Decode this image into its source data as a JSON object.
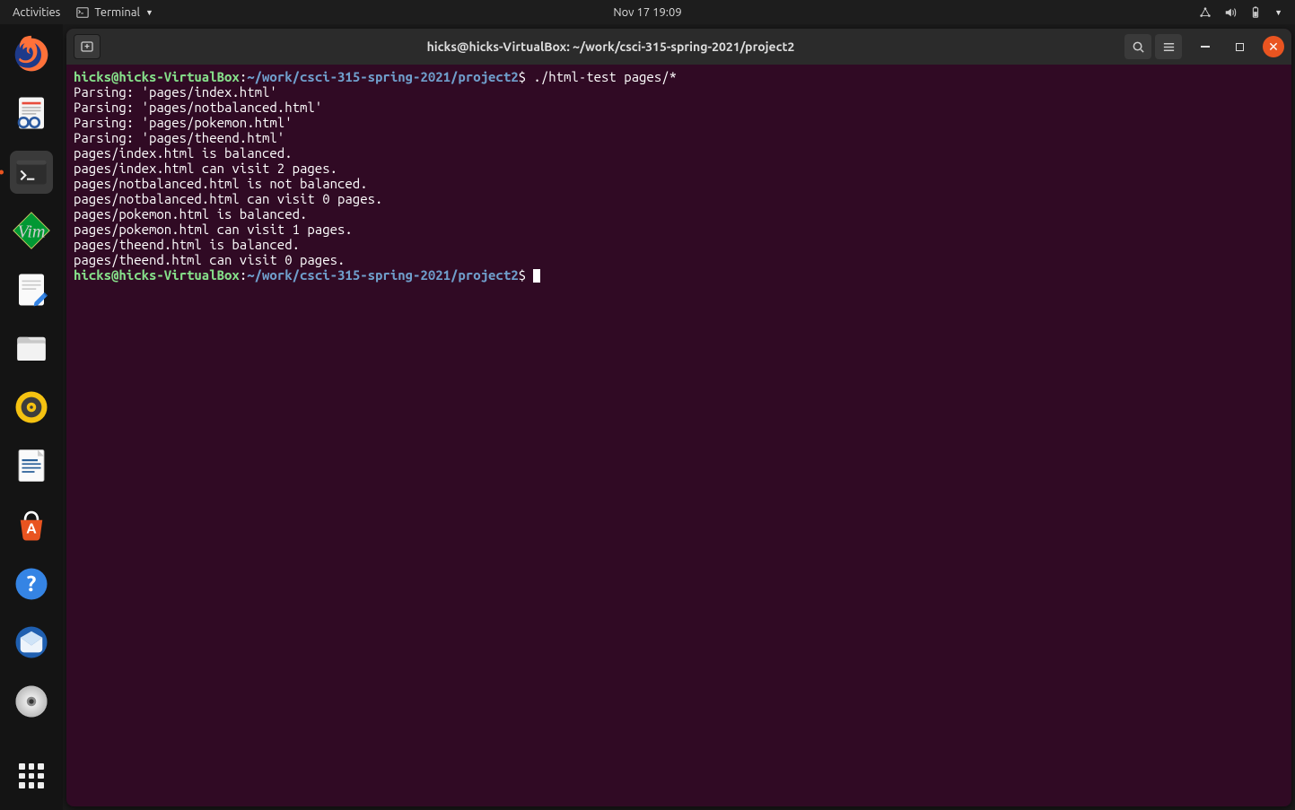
{
  "topbar": {
    "activities": "Activities",
    "app_menu_label": "Terminal",
    "clock": "Nov 17  19:09"
  },
  "window": {
    "title": "hicks@hicks-VirtualBox: ~/work/csci-315-spring-2021/project2"
  },
  "prompt": {
    "userhost": "hicks@hicks-VirtualBox",
    "sep": ":",
    "path": "~/work/csci-315-spring-2021/project2",
    "dlr": "$"
  },
  "term": {
    "command1": " ./html-test pages/*",
    "lines": [
      "Parsing: 'pages/index.html'",
      "Parsing: 'pages/notbalanced.html'",
      "Parsing: 'pages/pokemon.html'",
      "Parsing: 'pages/theend.html'",
      "pages/index.html is balanced.",
      "pages/index.html can visit 2 pages.",
      "pages/notbalanced.html is not balanced.",
      "pages/notbalanced.html can visit 0 pages.",
      "pages/pokemon.html is balanced.",
      "pages/pokemon.html can visit 1 pages.",
      "pages/theend.html is balanced.",
      "pages/theend.html can visit 0 pages."
    ],
    "command2": " "
  },
  "dock": {
    "items": [
      "firefox",
      "evince",
      "terminal",
      "vim",
      "gedit",
      "files",
      "rhythmbox",
      "writer",
      "software",
      "help",
      "thunderbird",
      "discs"
    ]
  }
}
